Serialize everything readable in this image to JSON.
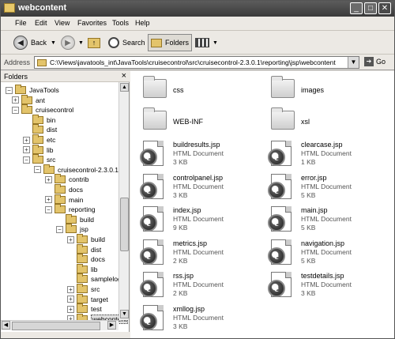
{
  "window": {
    "title": "webcontent"
  },
  "menubar": {
    "items": [
      "File",
      "Edit",
      "View",
      "Favorites",
      "Tools",
      "Help"
    ]
  },
  "toolbar": {
    "back_label": "Back",
    "search_label": "Search",
    "folders_label": "Folders"
  },
  "address": {
    "label": "Address",
    "path": "C:\\Views\\javatools_int\\JavaTools\\cruisecontrol\\src\\cruisecontrol-2.3.0.1\\reporting\\jsp\\webcontent",
    "go_label": "Go"
  },
  "folders_pane": {
    "title": "Folders",
    "tree": [
      {
        "label": "JavaTools",
        "exp": "−"
      },
      {
        "label": "ant",
        "exp": "+"
      },
      {
        "label": "cruisecontrol",
        "exp": "−"
      },
      {
        "label": "bin",
        "exp": ""
      },
      {
        "label": "dist",
        "exp": ""
      },
      {
        "label": "etc",
        "exp": "+"
      },
      {
        "label": "lib",
        "exp": "+"
      },
      {
        "label": "src",
        "exp": "−"
      },
      {
        "label": "cruisecontrol-2.3.0.1",
        "exp": "−"
      },
      {
        "label": "contrib",
        "exp": "+"
      },
      {
        "label": "docs",
        "exp": ""
      },
      {
        "label": "main",
        "exp": "+"
      },
      {
        "label": "reporting",
        "exp": "−"
      },
      {
        "label": "build",
        "exp": ""
      },
      {
        "label": "jsp",
        "exp": "−"
      },
      {
        "label": "build",
        "exp": "+"
      },
      {
        "label": "dist",
        "exp": ""
      },
      {
        "label": "docs",
        "exp": ""
      },
      {
        "label": "lib",
        "exp": ""
      },
      {
        "label": "samplelogs",
        "exp": ""
      },
      {
        "label": "src",
        "exp": "+"
      },
      {
        "label": "target",
        "exp": "+"
      },
      {
        "label": "test",
        "exp": "+"
      },
      {
        "label": "webcontent",
        "exp": "+"
      }
    ]
  },
  "content": {
    "folders": [
      "css",
      "images",
      "WEB-INF",
      "xsl"
    ],
    "files": [
      {
        "name": "buildresults.jsp",
        "type": "HTML Document",
        "size": "3 KB"
      },
      {
        "name": "clearcase.jsp",
        "type": "HTML Document",
        "size": "1 KB"
      },
      {
        "name": "controlpanel.jsp",
        "type": "HTML Document",
        "size": "3 KB"
      },
      {
        "name": "error.jsp",
        "type": "HTML Document",
        "size": "5 KB"
      },
      {
        "name": "index.jsp",
        "type": "HTML Document",
        "size": "9 KB"
      },
      {
        "name": "main.jsp",
        "type": "HTML Document",
        "size": "5 KB"
      },
      {
        "name": "metrics.jsp",
        "type": "HTML Document",
        "size": "2 KB"
      },
      {
        "name": "navigation.jsp",
        "type": "HTML Document",
        "size": "5 KB"
      },
      {
        "name": "rss.jsp",
        "type": "HTML Document",
        "size": "2 KB"
      },
      {
        "name": "testdetails.jsp",
        "type": "HTML Document",
        "size": "3 KB"
      },
      {
        "name": "xmllog.jsp",
        "type": "HTML Document",
        "size": "3 KB"
      }
    ]
  }
}
